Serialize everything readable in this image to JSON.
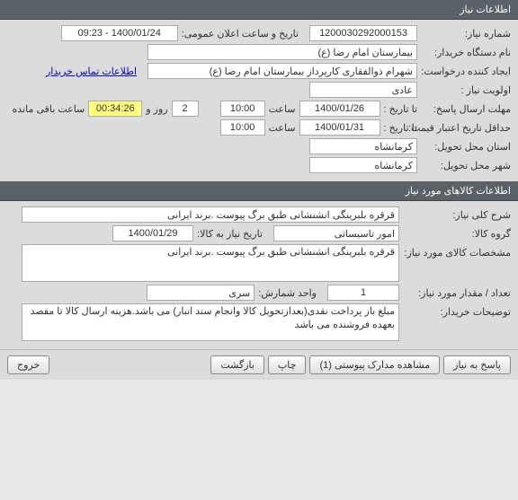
{
  "section1": {
    "title": "اطلاعات نیاز",
    "need_number_label": "شماره نیاز:",
    "need_number": "1200030292000153",
    "public_announce_label": "تاریخ و ساعت اعلان عمومی:",
    "public_announce": "1400/01/24 - 09:23",
    "buyer_label": "نام دستگاه خریدار:",
    "buyer": "بیمارستان امام رضا (ع)",
    "creator_label": "ایجاد کننده درخواست:",
    "creator": "شهرام ذوالفقاری کارپرداز بیمارستان امام رضا (ع)",
    "contact_link": "اطلاعات تماس خریدار",
    "priority_label": "اولویت نیاز :",
    "priority": "عادی",
    "deadline_label": "مهلت ارسال پاسخ:",
    "to_date_label": "تا تاریخ :",
    "deadline_date": "1400/01/26",
    "time_label": "ساعت",
    "deadline_time": "10:00",
    "days": "2",
    "days_label": "روز و",
    "countdown": "00:34:26",
    "remaining_label": "ساعت باقی مانده",
    "min_validity_label": "حداقل تاریخ اعتبار قیمت:",
    "validity_date": "1400/01/31",
    "validity_time": "10:00",
    "delivery_province_label": "استان محل تحویل:",
    "delivery_province": "کرمانشاه",
    "delivery_city_label": "شهر محل تحویل:",
    "delivery_city": "کرمانشاه"
  },
  "section2": {
    "title": "اطلاعات کالاهای مورد نیاز",
    "desc_label": "شرح کلی نیاز:",
    "desc": "قرقره بلبرینگی انشنشانی طبق برگ پیوست .برند ایرانی",
    "group_label": "گروه کالا:",
    "group": "امور تاسیساتی",
    "need_date_label": "تاریخ نیاز به کالا:",
    "need_date": "1400/01/29",
    "spec_label": "مشخصات کالای مورد نیاز:",
    "spec": "قرقره بلبرینگی انشنشانی طبق برگ پیوست .برند ایرانی",
    "qty_label": "تعداد / مقدار مورد نیاز:",
    "qty": "1",
    "unit_label": "واحد شمارش:",
    "unit": "سری",
    "notes_label": "توضیحات خریدار:",
    "notes": "مبلغ باز پرداخت نقدی(بعدازتحویل کالا وانجام سند انبار) می باشد.هزینه ارسال کالا تا مقصد بعهده فروشنده می باشد"
  },
  "buttons": {
    "reply": "پاسخ به نیاز",
    "attachments": "مشاهده مدارک پیوستی (1)",
    "print": "چاپ",
    "back": "بازگشت",
    "exit": "خروج"
  }
}
